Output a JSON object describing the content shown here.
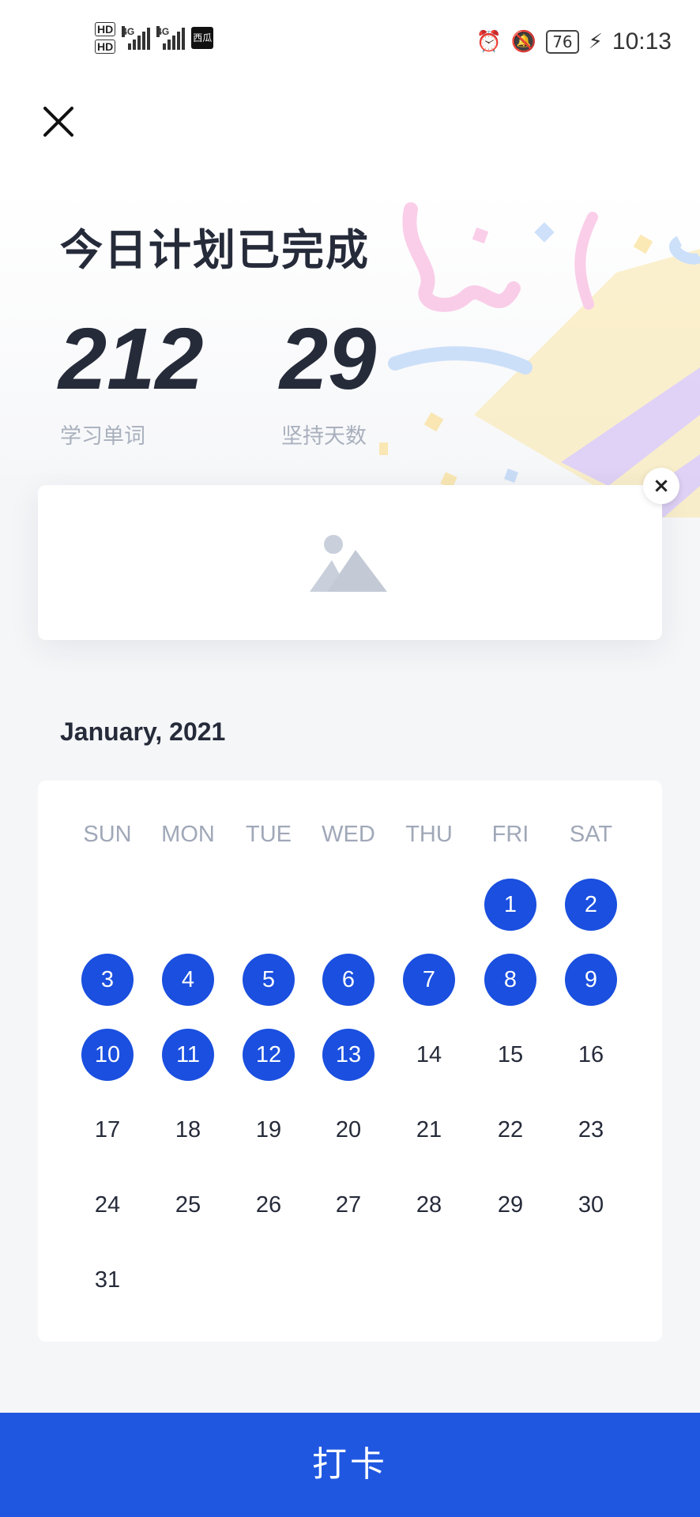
{
  "status_bar": {
    "hd1": "HD",
    "hd2": "HD",
    "sig1_label": "4G",
    "sig2_label": "4G",
    "app_badge": "西瓜",
    "battery": "76",
    "time": "10:13"
  },
  "headline": "今日计划已完成",
  "stats": [
    {
      "value": "212",
      "label": "学习单词"
    },
    {
      "value": "29",
      "label": "坚持天数"
    }
  ],
  "ad": {
    "close_label": "×",
    "image_icon": "image-placeholder-icon"
  },
  "calendar": {
    "month_label": "January, 2021",
    "weekdays": [
      "SUN",
      "MON",
      "TUE",
      "WED",
      "THU",
      "FRI",
      "SAT"
    ],
    "first_weekday_index": 5,
    "days_in_month": 31,
    "completed_days": [
      1,
      2,
      3,
      4,
      5,
      6,
      7,
      8,
      9,
      10,
      11,
      12,
      13
    ],
    "accent_color": "#1a4fdf"
  },
  "checkin_button": "打卡"
}
